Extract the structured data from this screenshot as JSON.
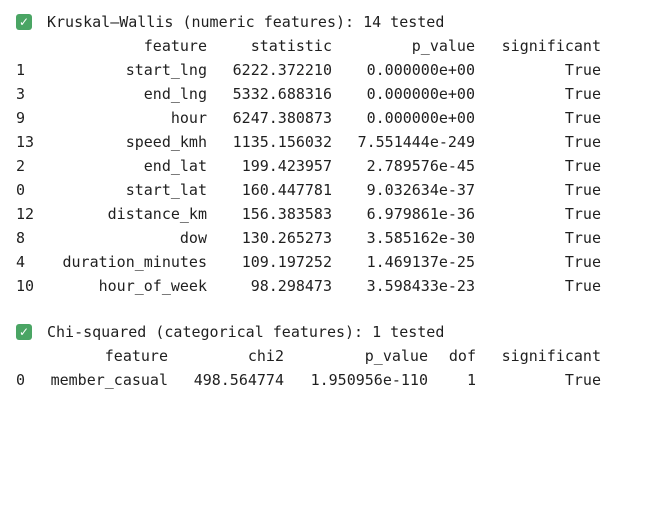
{
  "kruskal": {
    "heading": "Kruskal–Wallis (numeric features): 14 tested",
    "icon": "check-icon",
    "columns": [
      "feature",
      "statistic",
      "p_value",
      "significant"
    ],
    "rows": [
      {
        "idx": "1",
        "feature": "start_lng",
        "statistic": "6222.372210",
        "p_value": "0.000000e+00",
        "significant": "True"
      },
      {
        "idx": "3",
        "feature": "end_lng",
        "statistic": "5332.688316",
        "p_value": "0.000000e+00",
        "significant": "True"
      },
      {
        "idx": "9",
        "feature": "hour",
        "statistic": "6247.380873",
        "p_value": "0.000000e+00",
        "significant": "True"
      },
      {
        "idx": "13",
        "feature": "speed_kmh",
        "statistic": "1135.156032",
        "p_value": "7.551444e-249",
        "significant": "True"
      },
      {
        "idx": "2",
        "feature": "end_lat",
        "statistic": "199.423957",
        "p_value": "2.789576e-45",
        "significant": "True"
      },
      {
        "idx": "0",
        "feature": "start_lat",
        "statistic": "160.447781",
        "p_value": "9.032634e-37",
        "significant": "True"
      },
      {
        "idx": "12",
        "feature": "distance_km",
        "statistic": "156.383583",
        "p_value": "6.979861e-36",
        "significant": "True"
      },
      {
        "idx": "8",
        "feature": "dow",
        "statistic": "130.265273",
        "p_value": "3.585162e-30",
        "significant": "True"
      },
      {
        "idx": "4",
        "feature": "duration_minutes",
        "statistic": "109.197252",
        "p_value": "1.469137e-25",
        "significant": "True"
      },
      {
        "idx": "10",
        "feature": "hour_of_week",
        "statistic": "98.298473",
        "p_value": "3.598433e-23",
        "significant": "True"
      }
    ]
  },
  "chi": {
    "heading": "Chi-squared (categorical features): 1 tested",
    "icon": "check-icon",
    "columns": [
      "feature",
      "chi2",
      "p_value",
      "dof",
      "significant"
    ],
    "rows": [
      {
        "idx": "0",
        "feature": "member_casual",
        "chi2": "498.564774",
        "p_value": "1.950956e-110",
        "dof": "1",
        "significant": "True"
      }
    ]
  },
  "colors": {
    "check_bg": "#4aa564",
    "text": "#1f1f1f"
  }
}
